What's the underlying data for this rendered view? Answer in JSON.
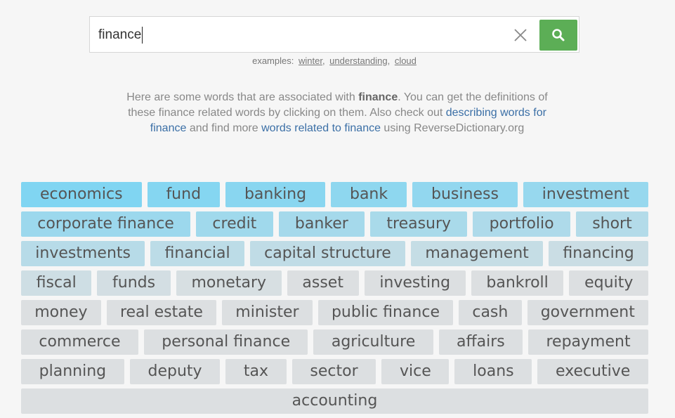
{
  "search": {
    "value": "finance",
    "clear_icon": "close-icon",
    "search_icon": "search-icon",
    "button_color": "#5cae56"
  },
  "examples": {
    "label": "examples:",
    "items": [
      "winter",
      "understanding",
      "cloud"
    ]
  },
  "intro": {
    "t1": "Here are some words that are associated with ",
    "term": "finance",
    "t2": ". You can get the definitions of these finance related words by clicking on them. Also check out ",
    "link1": "describing words for finance",
    "t3": " and find more ",
    "link2": "words related to finance",
    "t4": " using ReverseDictionary.org"
  },
  "tags": [
    [
      "economics",
      "fund",
      "banking",
      "bank",
      "business",
      "investment"
    ],
    [
      "corporate finance",
      "credit",
      "banker",
      "treasury",
      "portfolio",
      "short"
    ],
    [
      "investments",
      "financial",
      "capital structure",
      "management",
      "financing"
    ],
    [
      "fiscal",
      "funds",
      "monetary",
      "asset",
      "investing",
      "bankroll",
      "equity"
    ],
    [
      "money",
      "real estate",
      "minister",
      "public finance",
      "cash",
      "government"
    ],
    [
      "commerce",
      "personal finance",
      "agriculture",
      "affairs",
      "repayment"
    ],
    [
      "planning",
      "deputy",
      "tax",
      "sector",
      "vice",
      "loans",
      "executive"
    ],
    [
      "accounting"
    ]
  ],
  "tag_colors": {
    "strongest": "#80d5f2",
    "weakest": "#dcdfe1"
  }
}
